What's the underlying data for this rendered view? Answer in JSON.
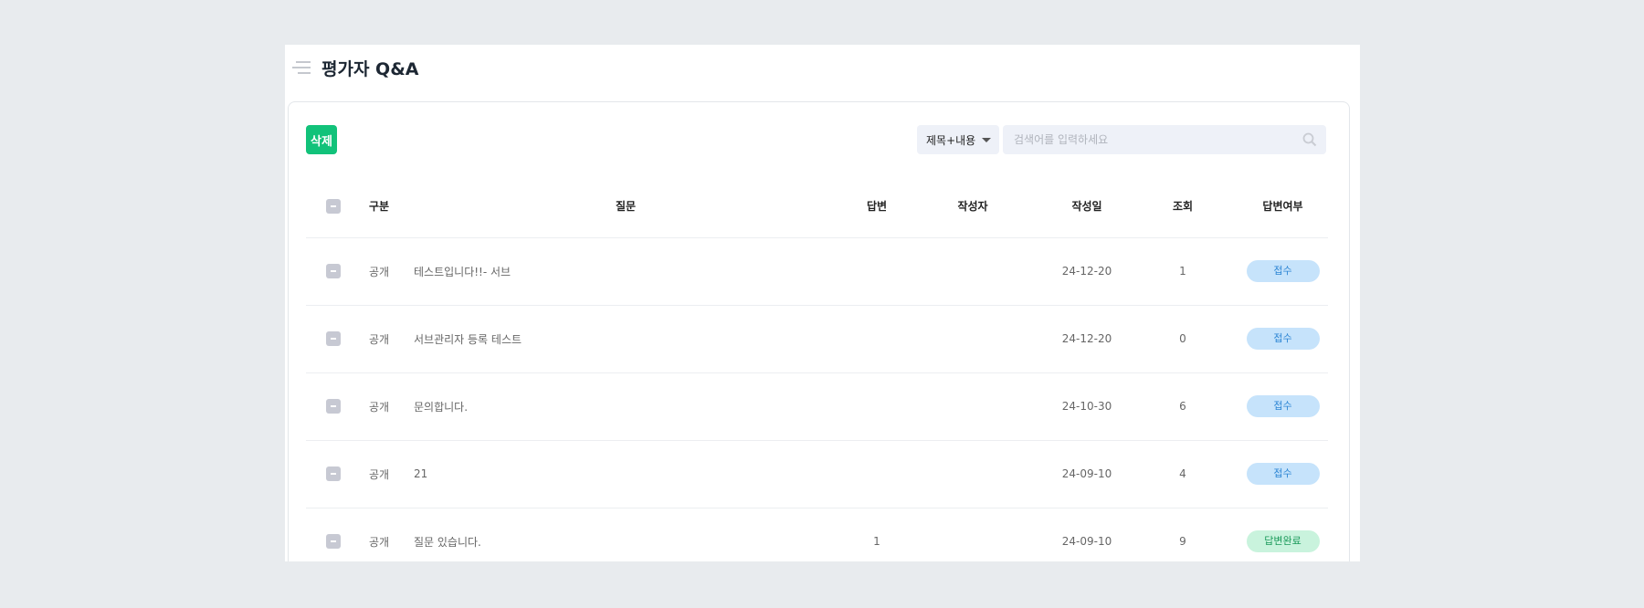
{
  "header": {
    "title": "평가자 Q&A"
  },
  "toolbar": {
    "delete_label": "삭제",
    "search_scope": "제목+내용",
    "search_placeholder": "검색어를 입력하세요",
    "search_value": ""
  },
  "table": {
    "columns": [
      "구분",
      "질문",
      "답변",
      "작성자",
      "작성일",
      "조회",
      "답변여부"
    ],
    "rows": [
      {
        "type": "공개",
        "question": "테스트입니다!!- 서브",
        "answers": "",
        "author": "",
        "date": "24-12-20",
        "views": "1",
        "status": "접수"
      },
      {
        "type": "공개",
        "question": "서브관리자 등록 테스트",
        "answers": "",
        "author": "",
        "date": "24-12-20",
        "views": "0",
        "status": "접수"
      },
      {
        "type": "공개",
        "question": "문의합니다.",
        "answers": "",
        "author": "",
        "date": "24-10-30",
        "views": "6",
        "status": "접수"
      },
      {
        "type": "공개",
        "question": "21",
        "answers": "",
        "author": "",
        "date": "24-09-10",
        "views": "4",
        "status": "접수"
      },
      {
        "type": "공개",
        "question": "질문 있습니다.",
        "answers": "1",
        "author": "",
        "date": "24-09-10",
        "views": "9",
        "status": "답변완료"
      }
    ]
  },
  "colors": {
    "accent": "#12c27a",
    "badge_received": "#c6e3fb",
    "badge_done": "#c9f3dd"
  }
}
